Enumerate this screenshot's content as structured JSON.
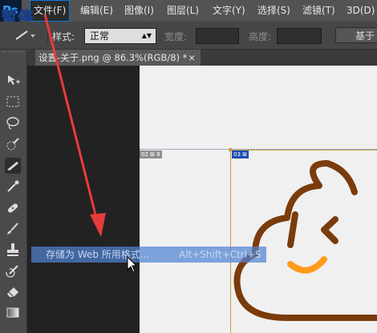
{
  "menubar": {
    "logo": "Ps",
    "items": [
      "文件(F)",
      "编辑(E)",
      "图像(I)",
      "图层(L)",
      "文字(Y)",
      "选择(S)",
      "滤镜(T)",
      "3D(D)"
    ]
  },
  "overlay": {
    "pause_label": "暂停"
  },
  "options": {
    "style_label": "样式:",
    "style_value": "正常",
    "width_label": "宽度:",
    "height_label": "高度:",
    "button_partial": "基于"
  },
  "document": {
    "tab_title": "设置-关于.png @ 86.3%(RGB/8) *",
    "close_glyph": "×"
  },
  "slices": {
    "slice_02": "02",
    "slice_03": "03"
  },
  "context_menu": {
    "item_label": "存储为 Web 所用格式...",
    "shortcut": "Alt+Shift+Ctrl+S"
  },
  "colors": {
    "accent": "#0b7de0",
    "menu_highlight": "#5082d2",
    "arrow": "#e83b3b",
    "icon_brown": "#7a3c0c",
    "icon_orange": "#ff9a1a"
  },
  "icons": [
    "pause-badge",
    "move-tool-icon",
    "marquee-tool-icon",
    "lasso-tool-icon",
    "quick-select-icon",
    "slice-tool-icon",
    "eyedropper-icon",
    "healing-brush-icon",
    "brush-icon",
    "clone-stamp-icon",
    "history-brush-icon",
    "eraser-icon",
    "gradient-icon",
    "cursor-icon"
  ]
}
